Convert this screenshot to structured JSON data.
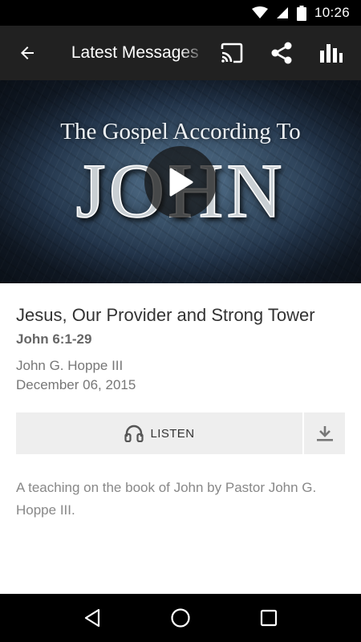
{
  "status_bar": {
    "time": "10:26",
    "icons": [
      "wifi-icon",
      "cell-signal-icon",
      "battery-icon"
    ]
  },
  "app_bar": {
    "back_icon": "arrow-back-icon",
    "title": "Latest Messages",
    "actions": [
      "cast-icon",
      "share-icon",
      "bar-chart-icon"
    ]
  },
  "hero": {
    "subtitle": "The Gospel According To",
    "title": "JOHN",
    "play_icon": "play-icon"
  },
  "message": {
    "title": "Jesus, Our Provider and Strong Tower",
    "scripture": "John 6:1-29",
    "speaker": "John G. Hoppe III",
    "date": "December 06, 2015",
    "listen_label": "LISTEN",
    "listen_icon": "headphones-icon",
    "download_icon": "download-icon",
    "description": "A teaching on the book of John by Pastor John G. Hoppe III."
  },
  "nav_bar": {
    "icons": [
      "nav-back-icon",
      "nav-home-icon",
      "nav-recents-icon"
    ]
  },
  "colors": {
    "app_bar": "#212121",
    "status_bar": "#000000",
    "button_bg": "#eeeeee",
    "primary_text": "#333333",
    "secondary_text": "#777777"
  }
}
